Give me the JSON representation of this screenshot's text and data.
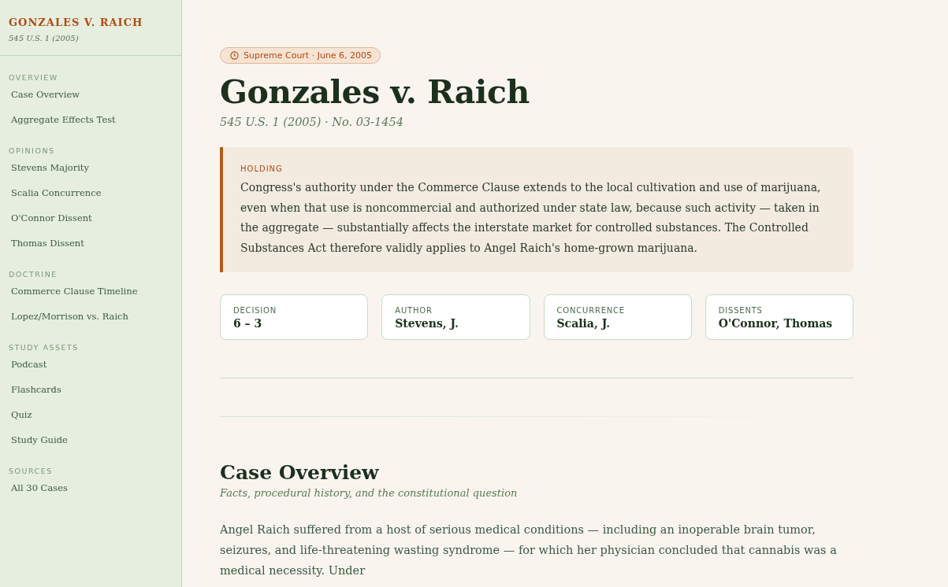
{
  "sidebar": {
    "title": "GONZALES V. RAICH",
    "subtitle": "545 U.S. 1 (2005)",
    "sections": [
      {
        "heading": "OVERVIEW",
        "items": [
          {
            "label": "Case Overview",
            "selected": false
          },
          {
            "label": "Aggregate Effects Test",
            "selected": false
          }
        ]
      },
      {
        "heading": "OPINIONS",
        "items": [
          {
            "label": "Stevens Majority",
            "selected": false
          },
          {
            "label": "Scalia Concurrence",
            "selected": false
          },
          {
            "label": "O'Connor Dissent",
            "selected": false
          },
          {
            "label": "Thomas Dissent",
            "selected": false
          }
        ]
      },
      {
        "heading": "DOCTRINE",
        "items": [
          {
            "label": "Commerce Clause Timeline",
            "selected": false
          },
          {
            "label": "Lopez/Morrison vs. Raich",
            "selected": false
          }
        ]
      },
      {
        "heading": "STUDY ASSETS",
        "items": [
          {
            "label": "Podcast",
            "selected": false
          },
          {
            "label": "Flashcards",
            "selected": false
          },
          {
            "label": "Quiz",
            "selected": false
          },
          {
            "label": "Study Guide",
            "selected": false
          }
        ]
      },
      {
        "heading": "SOURCES",
        "items": [
          {
            "label": "All 30 Cases",
            "selected": false
          }
        ]
      }
    ]
  },
  "header": {
    "badge": "Supreme Court · June 6, 2005",
    "title": "Gonzales v. Raich",
    "citation": "545 U.S. 1 (2005) · No. 03-1454"
  },
  "holding": {
    "label": "HOLDING",
    "text": "Congress's authority under the Commerce Clause extends to the local cultivation and use of marijuana, even when that use is noncommercial and authorized under state law, because such activity — taken in the aggregate — substantially affects the interstate market for controlled substances. The Controlled Substances Act therefore validly applies to Angel Raich's home-grown marijuana."
  },
  "facts": [
    {
      "label": "DECISION",
      "value": "6 – 3"
    },
    {
      "label": "AUTHOR",
      "value": "Stevens, J."
    },
    {
      "label": "CONCURRENCE",
      "value": "Scalia, J."
    },
    {
      "label": "DISSENTS",
      "value": "O'Connor, Thomas"
    }
  ],
  "section": {
    "title": "Case Overview",
    "subtitle": "Facts, procedural history, and the constitutional question",
    "body": "Angel Raich suffered from a host of serious medical conditions — including an inoperable brain tumor, seizures, and life-threatening wasting syndrome — for which her physician concluded that cannabis was a medical necessity. Under"
  }
}
